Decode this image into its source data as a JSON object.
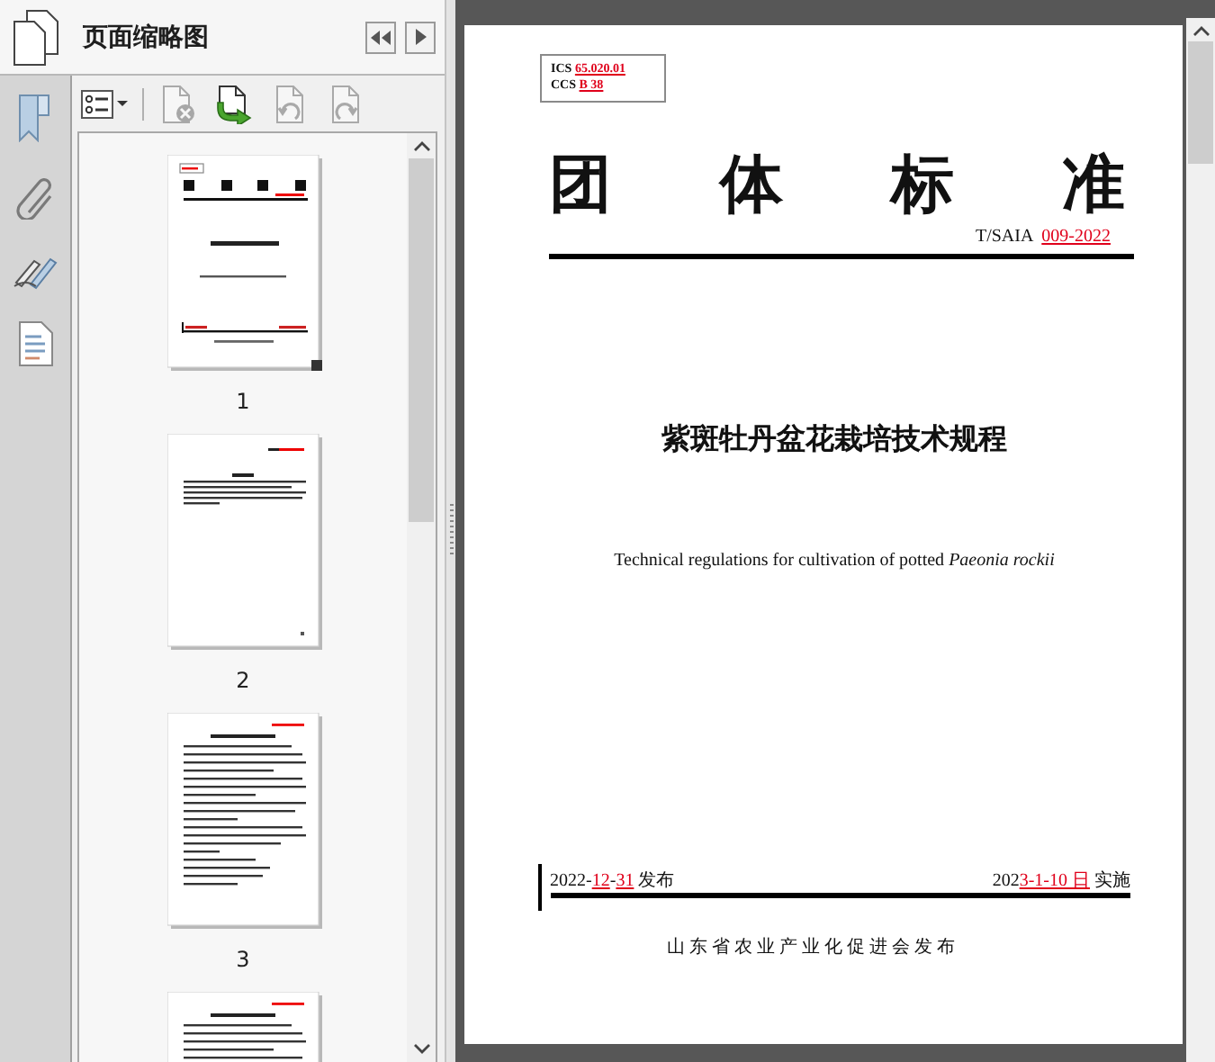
{
  "sidebar": {
    "title": "页面缩略图",
    "toolbar": [
      {
        "kind": "options",
        "disabled": false
      },
      {
        "kind": "delete",
        "disabled": true
      },
      {
        "kind": "insert",
        "disabled": false
      },
      {
        "kind": "rotate_left",
        "disabled": true
      },
      {
        "kind": "rotate_right",
        "disabled": true
      }
    ],
    "thumbnails": [
      {
        "kind": "cover",
        "label": "1",
        "selected": true
      },
      {
        "kind": "preface",
        "label": "2",
        "selected": false
      },
      {
        "kind": "body",
        "label": "3",
        "selected": false
      },
      {
        "kind": "body"
      }
    ]
  },
  "page": {
    "codes": [
      {
        "segments": [
          {
            "text": "ICS ",
            "marked": false
          },
          {
            "text": "65.020.01",
            "marked": true
          }
        ]
      },
      {
        "segments": [
          {
            "text": "CCS ",
            "marked": false
          },
          {
            "text": "B 38",
            "marked": true
          }
        ]
      }
    ],
    "heading": "团 体 标 准",
    "standard_number": {
      "segments": [
        {
          "text": "T/SAIA  ",
          "marked": false
        },
        {
          "text": "009-2022",
          "marked": true
        }
      ]
    },
    "title": "紫斑牡丹盆花栽培技术规程",
    "english_title": "Technical regulations for cultivation of potted *Paeonia rockii*",
    "release_date": {
      "segments": [
        {
          "text": "2022-",
          "marked": false
        },
        {
          "text": "12",
          "marked": true
        },
        {
          "text": "-",
          "marked": false
        },
        {
          "text": "31",
          "marked": true
        },
        {
          "text": " 发布",
          "marked": false
        }
      ]
    },
    "implementation_date": {
      "segments": [
        {
          "text": "202",
          "marked": false
        },
        {
          "text": "3-1-10 日",
          "marked": true
        },
        {
          "text": " 实施",
          "marked": false
        }
      ]
    },
    "publisher": "山东省农业产业化促进会发布"
  }
}
